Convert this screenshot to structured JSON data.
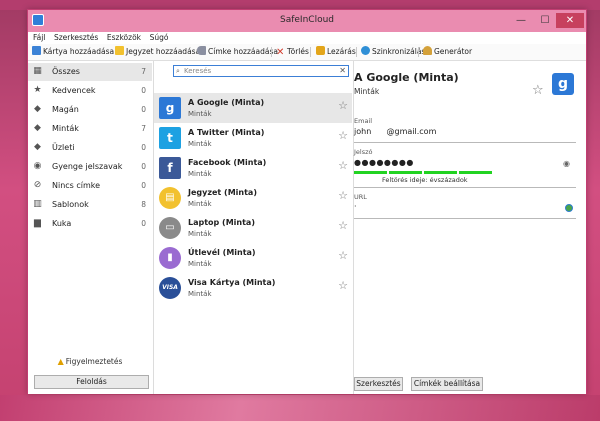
{
  "window": {
    "title": "SafeInCloud",
    "controls": {
      "minimize": "—",
      "maximize": "☐",
      "close": "✕"
    }
  },
  "menu": [
    "Fájl",
    "Szerkesztés",
    "Eszközök",
    "Súgó"
  ],
  "toolbar": {
    "add_card": "Kártya hozzáadása",
    "add_note": "Jegyzet hozzáadása",
    "add_label": "Címke hozzáadása",
    "delete": "Törlés",
    "lock": "Lezárás",
    "sync": "Szinkronizálás",
    "generator": "Generátor"
  },
  "sidebar": {
    "items": [
      {
        "label": "Összes",
        "count": "7",
        "icon": "grid-icon"
      },
      {
        "label": "Kedvencek",
        "count": "0",
        "icon": "star-icon"
      },
      {
        "label": "Magán",
        "count": "0",
        "icon": "tag-icon"
      },
      {
        "label": "Minták",
        "count": "7",
        "icon": "tag-icon"
      },
      {
        "label": "Üzleti",
        "count": "0",
        "icon": "tag-icon"
      },
      {
        "label": "Gyenge jelszavak",
        "count": "0",
        "icon": "weak-password-icon"
      },
      {
        "label": "Nincs címke",
        "count": "0",
        "icon": "no-tag-icon"
      },
      {
        "label": "Sablonok",
        "count": "8",
        "icon": "templates-icon"
      },
      {
        "label": "Kuka",
        "count": "0",
        "icon": "trash-icon"
      }
    ],
    "warning": "Figyelmeztetés",
    "unlock": "Feloldás"
  },
  "search": {
    "placeholder": "Keresés",
    "value": ""
  },
  "cards": [
    {
      "name": "A Google (Minta)",
      "sub": "Minták",
      "icon": "google-icon",
      "glyph": "g",
      "color": "#2c78d6"
    },
    {
      "name": "A Twitter (Minta)",
      "sub": "Minták",
      "icon": "twitter-icon",
      "glyph": "t",
      "color": "#1da1e2"
    },
    {
      "name": "Facebook (Minta)",
      "sub": "Minták",
      "icon": "facebook-icon",
      "glyph": "f",
      "color": "#3b5998"
    },
    {
      "name": "Jegyzet (Minta)",
      "sub": "Minták",
      "icon": "note-icon",
      "glyph": "▤",
      "color": "#f2c12e"
    },
    {
      "name": "Laptop (Minta)",
      "sub": "Minták",
      "icon": "laptop-icon",
      "glyph": "▭",
      "color": "#8a8a8a"
    },
    {
      "name": "Útlevél (Minta)",
      "sub": "Minták",
      "icon": "passport-icon",
      "glyph": "▮",
      "color": "#9a6bd1"
    },
    {
      "name": "Visa Kártya (Minta)",
      "sub": "Minták",
      "icon": "visa-icon",
      "glyph": "VISA",
      "color": "#2a4f98"
    }
  ],
  "details": {
    "title": "A Google (Minta)",
    "subtitle": "Minták",
    "fields": {
      "email_label": "Email",
      "email_value": "john      @gmail.com",
      "password_label": "Jelszó",
      "password_value": "●●●●●●●●",
      "crack_time": "Feltörés ideje: évszázadok",
      "url_label": "URL",
      "url_value": "·"
    },
    "edit_button": "Szerkesztés",
    "labels_button": "Címkék beállítása",
    "strength_color": "#22d322"
  }
}
